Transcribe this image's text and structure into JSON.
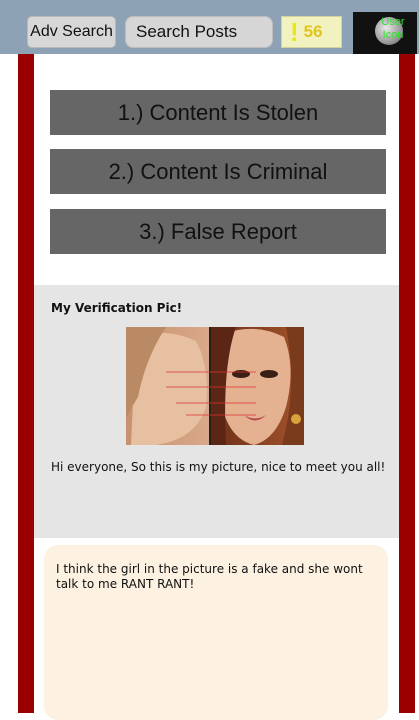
{
  "header": {
    "adv_search_label": "Adv Search",
    "search_placeholder": "Search Posts",
    "alert_glyph": "!",
    "alert_count": "56",
    "user_icon_label": "User Icon"
  },
  "report_options": [
    {
      "label": "1.) Content Is Stolen"
    },
    {
      "label": "2.) Content Is Criminal"
    },
    {
      "label": "3.) False Report"
    }
  ],
  "post": {
    "title": "My Verification Pic!",
    "text": "Hi everyone, So this is my picture, nice to meet you all!"
  },
  "comment": {
    "text": "I think the girl in the picture is a fake and she wont talk to me RANT RANT!"
  },
  "colors": {
    "top_bar": "#8ea2b6",
    "rail": "#9b0000",
    "option_bg": "#666666",
    "post_bg": "#e5e5e5",
    "comment_bg": "#fdf1e1",
    "alert_accent": "#e6e61a"
  }
}
